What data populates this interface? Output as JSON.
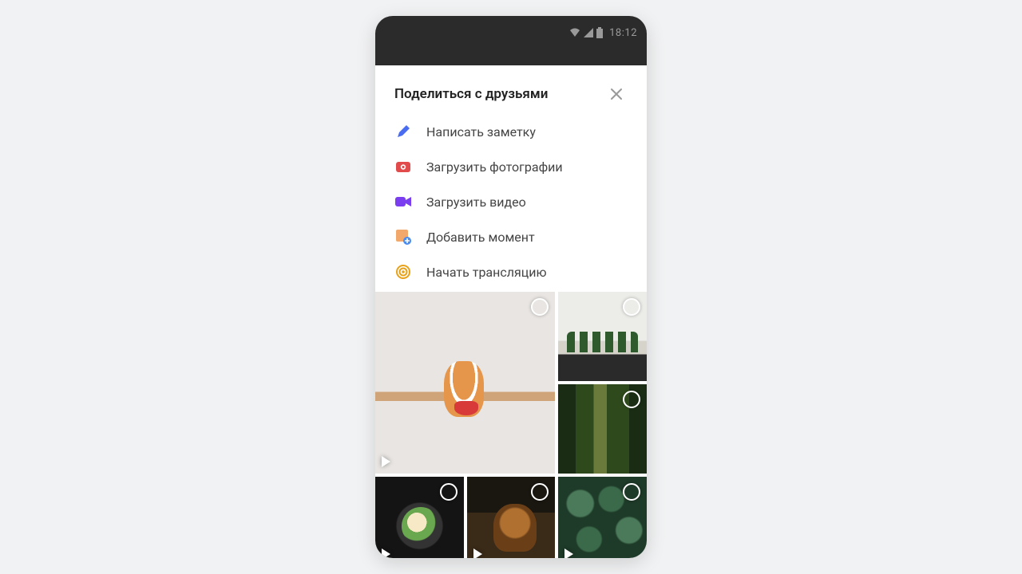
{
  "status": {
    "time": "18:12"
  },
  "sheet": {
    "title": "Поделиться с друзьями",
    "actions": [
      {
        "id": "write-note",
        "label": "Написать заметку"
      },
      {
        "id": "upload-photos",
        "label": "Загрузить фотографии"
      },
      {
        "id": "upload-video",
        "label": "Загрузить видео"
      },
      {
        "id": "add-moment",
        "label": "Добавить момент"
      },
      {
        "id": "start-stream",
        "label": "Начать трансляцию"
      }
    ]
  },
  "gallery_tiles": [
    {
      "id": "cat",
      "is_video": true,
      "large": true
    },
    {
      "id": "plants",
      "is_video": false,
      "large": false
    },
    {
      "id": "forest",
      "is_video": false,
      "large": false
    },
    {
      "id": "food",
      "is_video": true,
      "large": false
    },
    {
      "id": "catlook",
      "is_video": true,
      "large": false
    },
    {
      "id": "succulents",
      "is_video": true,
      "large": false
    }
  ],
  "colors": {
    "pencil": "#4a6cf1",
    "camera": "#e24b4b",
    "video": "#7a3df0",
    "moment": "#f2a86a",
    "momentPlus": "#4a8cf0",
    "stream": "#e8a21a"
  }
}
